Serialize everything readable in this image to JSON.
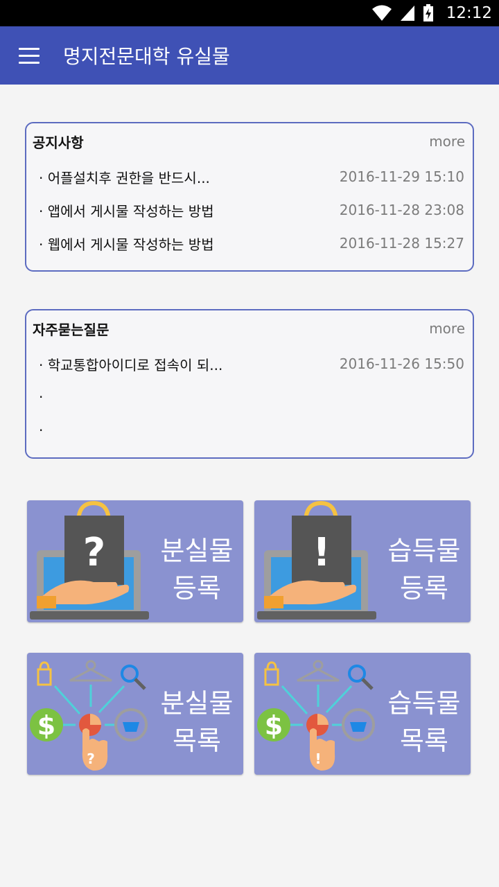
{
  "status_bar": {
    "time": "12:12",
    "icons": [
      "wifi-icon",
      "signal-icon",
      "battery-charging-icon"
    ]
  },
  "app_bar": {
    "title": "명지전문대학 유실물",
    "menu_icon": "hamburger-menu-icon"
  },
  "notice_card": {
    "title": "공지사항",
    "more": "more",
    "items": [
      {
        "title": "어플설치후 권한을 반드시...",
        "date": "2016-11-29 15:10"
      },
      {
        "title": "앱에서 게시물 작성하는 방법",
        "date": "2016-11-28 23:08"
      },
      {
        "title": "웹에서 게시물 작성하는 방법",
        "date": "2016-11-28 15:27"
      }
    ]
  },
  "faq_card": {
    "title": "자주묻는질문",
    "more": "more",
    "items": [
      {
        "title": "학교통합아이디로 접속이 되...",
        "date": "2016-11-26 15:50"
      },
      {
        "title": "",
        "date": ""
      },
      {
        "title": "",
        "date": ""
      }
    ]
  },
  "tiles": [
    {
      "line1": "분실물",
      "line2": "등록",
      "icon": "question-shopping-bag-laptop-icon"
    },
    {
      "line1": "습득물",
      "line2": "등록",
      "icon": "exclamation-shopping-bag-laptop-icon"
    },
    {
      "line1": "분실물",
      "line2": "목록",
      "icon": "question-hand-network-icon"
    },
    {
      "line1": "습득물",
      "line2": "목록",
      "icon": "exclamation-hand-network-icon"
    }
  ],
  "colors": {
    "primary": "#3f51b5",
    "card_border": "#5c6bc0",
    "tile_bg": "#8a92d0",
    "background": "#f4f4f4"
  }
}
